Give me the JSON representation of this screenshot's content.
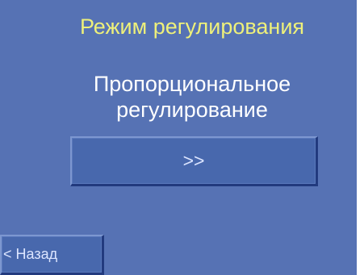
{
  "screen": {
    "title": "Режим регулирования",
    "mode_line_1": "Пропорциональное",
    "mode_line_2": "регулирование",
    "next_button_label": ">>",
    "back_button_label": "< Назад"
  },
  "colors": {
    "background": "#5672b4",
    "button_face": "#4868ad",
    "title_text": "#eef07a",
    "mode_text": "#ffffff",
    "button_text": "#dce5ff"
  }
}
